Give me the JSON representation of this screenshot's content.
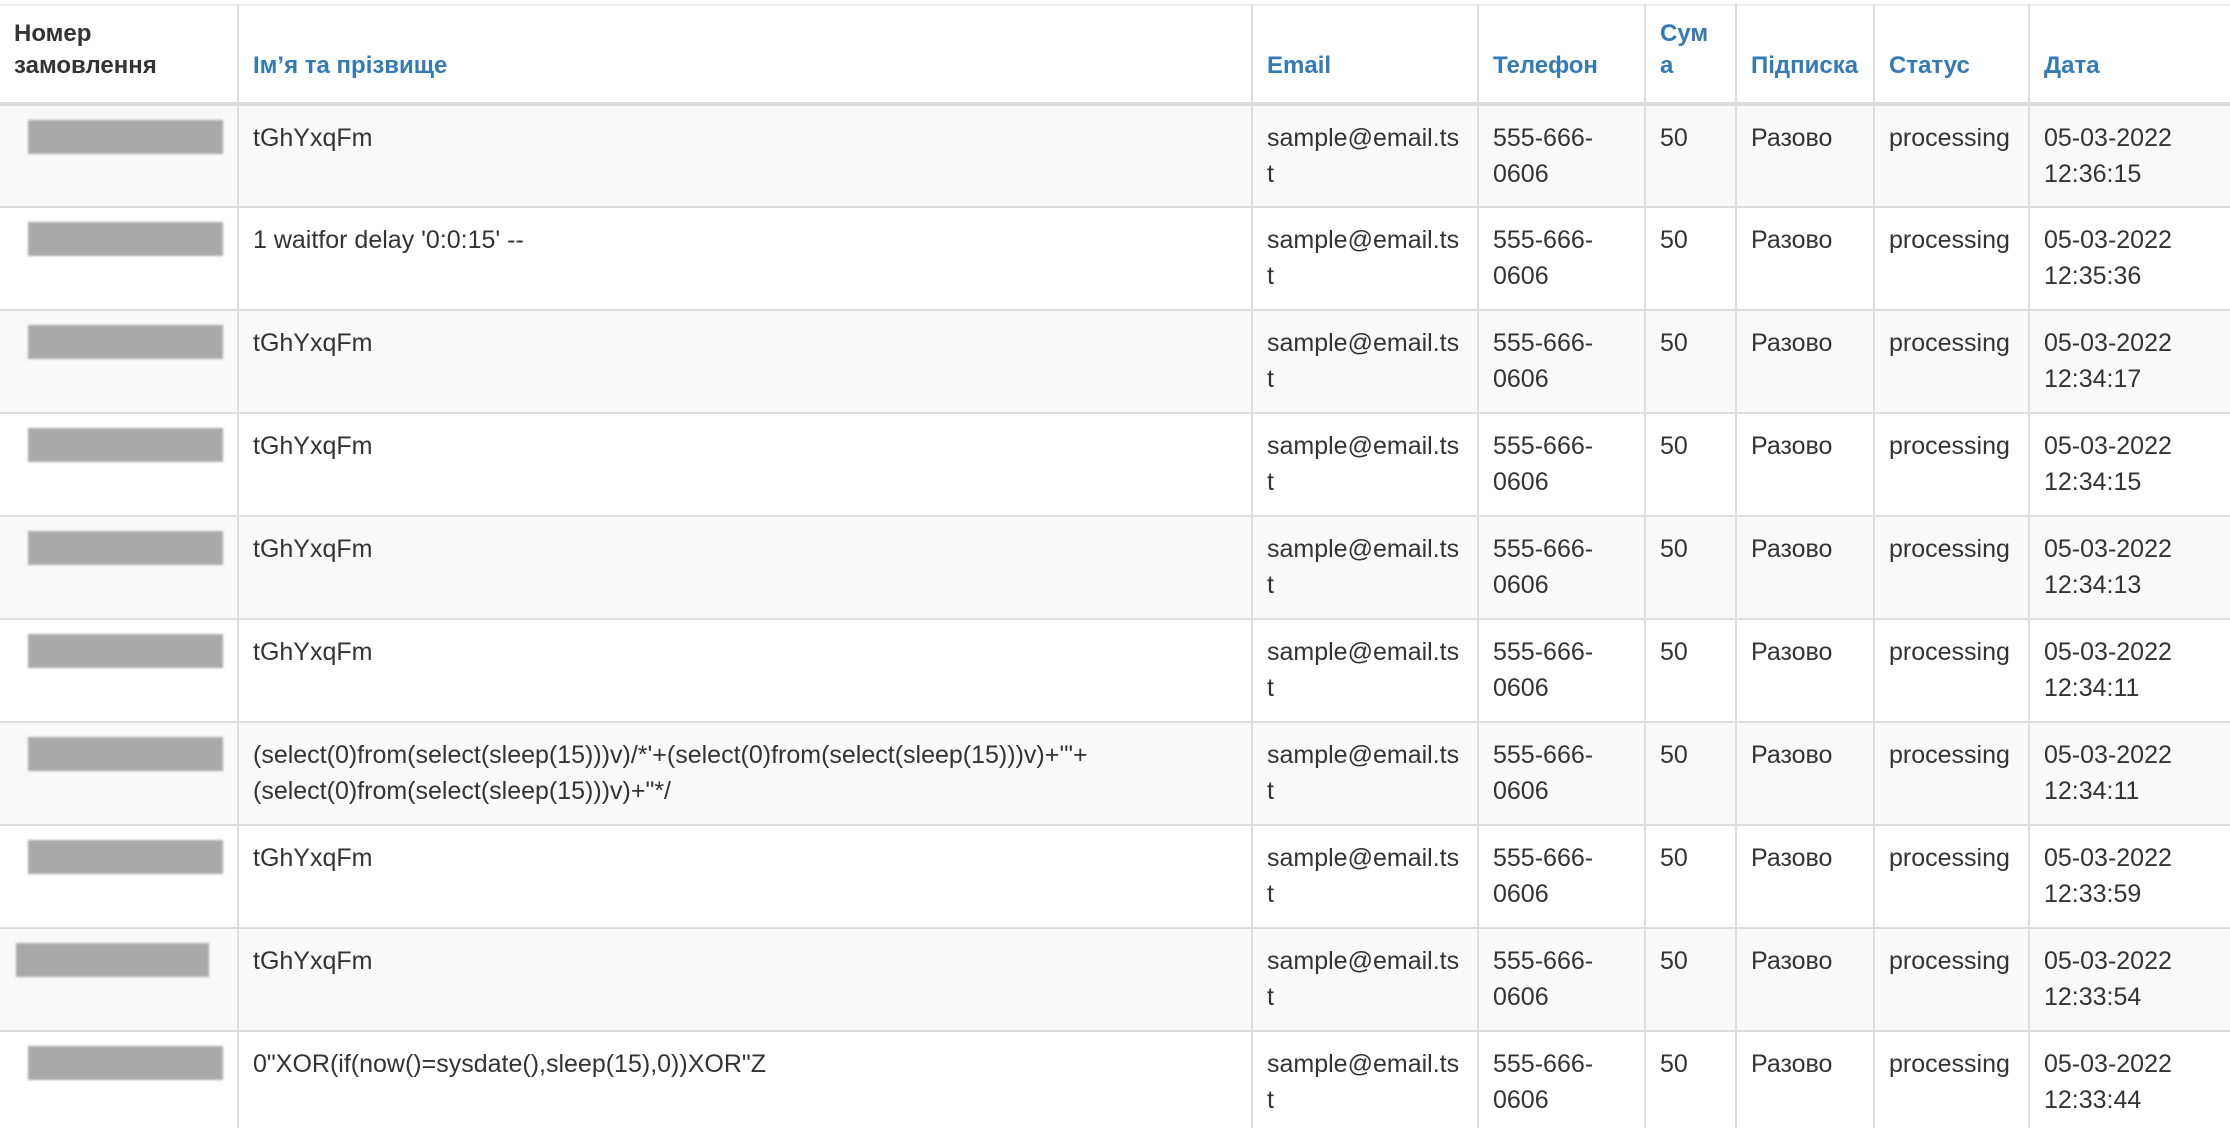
{
  "table": {
    "headers": {
      "order_number": "Номер замовлення",
      "name": "Ім’я та прізвище",
      "email": "Email",
      "phone": "Телефон",
      "amount": "Сума",
      "subscription": "Підписка",
      "status": "Статус",
      "date": "Дата"
    },
    "rows": [
      {
        "name": "tGhYxqFm",
        "email": "sample@email.tst",
        "phone": "555-666-0606",
        "amount": "50",
        "subscription": "Разово",
        "status": "processing",
        "date": "05-03-2022 12:36:15"
      },
      {
        "name": "1 waitfor delay '0:0:15' --",
        "email": "sample@email.tst",
        "phone": "555-666-0606",
        "amount": "50",
        "subscription": "Разово",
        "status": "processing",
        "date": "05-03-2022 12:35:36"
      },
      {
        "name": "tGhYxqFm",
        "email": "sample@email.tst",
        "phone": "555-666-0606",
        "amount": "50",
        "subscription": "Разово",
        "status": "processing",
        "date": "05-03-2022 12:34:17"
      },
      {
        "name": "tGhYxqFm",
        "email": "sample@email.tst",
        "phone": "555-666-0606",
        "amount": "50",
        "subscription": "Разово",
        "status": "processing",
        "date": "05-03-2022 12:34:15"
      },
      {
        "name": "tGhYxqFm",
        "email": "sample@email.tst",
        "phone": "555-666-0606",
        "amount": "50",
        "subscription": "Разово",
        "status": "processing",
        "date": "05-03-2022 12:34:13"
      },
      {
        "name": "tGhYxqFm",
        "email": "sample@email.tst",
        "phone": "555-666-0606",
        "amount": "50",
        "subscription": "Разово",
        "status": "processing",
        "date": "05-03-2022 12:34:11"
      },
      {
        "name": "(select(0)from(select(sleep(15)))v)/*'+(select(0)from(select(sleep(15)))v)+'\"+(select(0)from(select(sleep(15)))v)+\"*/",
        "email": "sample@email.tst",
        "phone": "555-666-0606",
        "amount": "50",
        "subscription": "Разово",
        "status": "processing",
        "date": "05-03-2022 12:34:11"
      },
      {
        "name": "tGhYxqFm",
        "email": "sample@email.tst",
        "phone": "555-666-0606",
        "amount": "50",
        "subscription": "Разово",
        "status": "processing",
        "date": "05-03-2022 12:33:59"
      },
      {
        "name": "tGhYxqFm",
        "email": "sample@email.tst",
        "phone": "555-666-0606",
        "amount": "50",
        "subscription": "Разово",
        "status": "processing",
        "date": "05-03-2022 12:33:54"
      },
      {
        "name": "0\"XOR(if(now()=sysdate(),sleep(15),0))XOR\"Z",
        "email": "sample@email.tst",
        "phone": "555-666-0606",
        "amount": "50",
        "subscription": "Разово",
        "status": "processing",
        "date": "05-03-2022 12:33:44"
      }
    ]
  },
  "colors": {
    "header_link": "#337ab7",
    "text": "#333333",
    "stripe": "#f9f9f9",
    "border": "#dddddd",
    "redaction": "#a9a9a9"
  }
}
